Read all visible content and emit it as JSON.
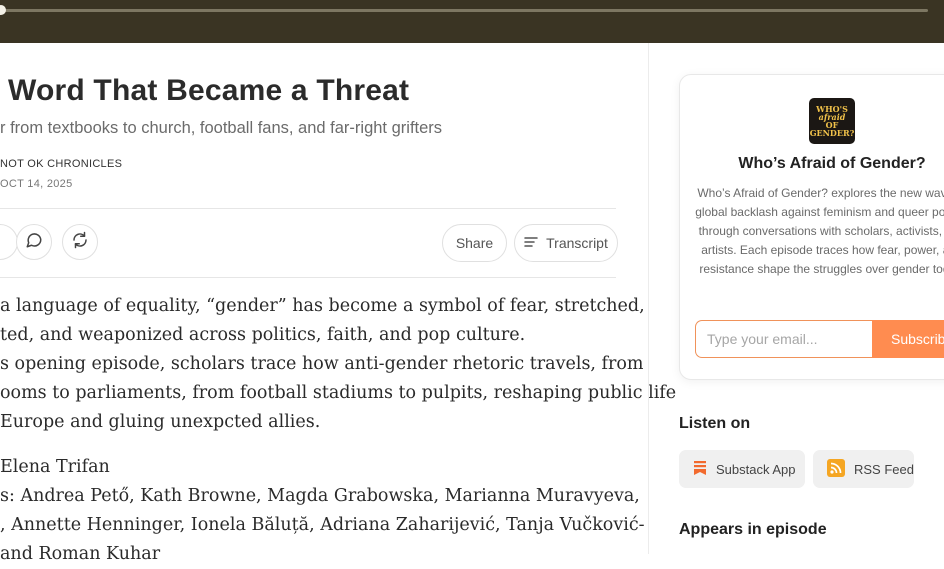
{
  "player": {
    "progress": 0.0
  },
  "post": {
    "title": "Word That Became a Threat",
    "subtitle": "r from textbooks to church, football fans, and far-right grifters",
    "publisher": "NOT OK CHRONICLES",
    "date": "OCT 14, 2025"
  },
  "actions": {
    "share_label": "Share",
    "transcript_label": "Transcript"
  },
  "body": {
    "lines": [
      "a language of equality, “gender” has become a symbol of fear, stretched,",
      "ted, and weaponized across politics, faith, and pop culture.",
      "s opening episode, scholars trace how anti-gender rhetoric travels, from",
      "ooms to parliaments, from football stadiums to pulpits, reshaping public life",
      " Europe and gluing unexpcted allies."
    ],
    "credits": [
      "Elena Trifan",
      "s: Andrea Pető, Kath Browne, Magda Grabowska, Marianna Muravyeva,",
      ", Annette Henninger, Ionela Băluță, Adriana Zaharijević, Tanja Vučković-",
      " and Roman Kuhar"
    ]
  },
  "sidebar": {
    "podcast_cover_text": [
      "WHO'S",
      "afraid",
      "OF",
      "GENDER?"
    ],
    "podcast_title": "Who’s Afraid of Gender?",
    "podcast_description": "Who’s Afraid of Gender? explores the new wave of global backlash against feminism and queer politics through conversations with scholars, activists, and artists. Each episode traces how fear, power, and resistance shape the struggles over gender today.",
    "email_placeholder": "Type your email...",
    "subscribe_label": "Subscribe",
    "listen_on_heading": "Listen on",
    "listen_options": [
      "Substack App",
      "RSS Feed"
    ],
    "appears_heading": "Appears in episode"
  },
  "colors": {
    "player_bg": "#3a3423",
    "accent": "#ff8c50",
    "substack_icon": "#f26a2e",
    "rss_icon": "#f5a623"
  },
  "icons": [
    "comment-icon",
    "restack-icon",
    "transcript-icon",
    "substack-icon",
    "rss-icon"
  ]
}
